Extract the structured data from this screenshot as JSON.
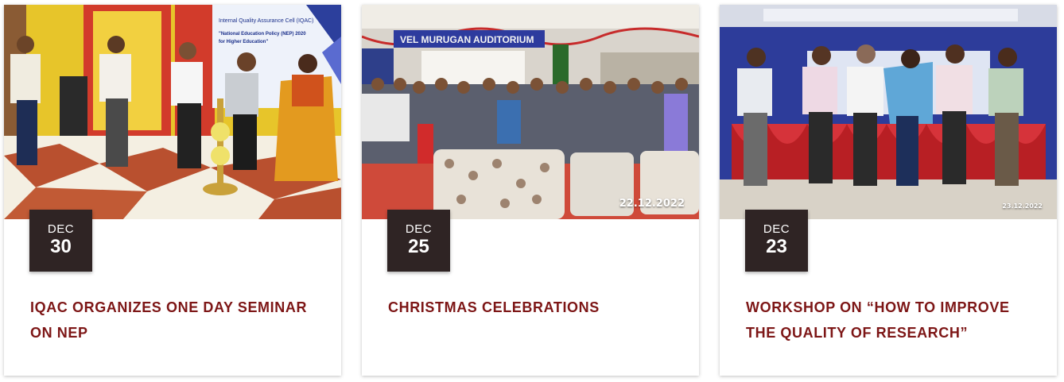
{
  "events": [
    {
      "month": "DEC",
      "day": "30",
      "title": "IQAC ORGANIZES ONE DAY SEMINAR ON NEP",
      "photo_text": [
        "Internal Quality Assurance Cell (IQAC)",
        "\"National Education Policy (NEP) 2020",
        "for Higher Education\""
      ]
    },
    {
      "month": "DEC",
      "day": "25",
      "title": "CHRISTMAS CELEBRATIONS",
      "photo_text": [
        "VEL MURUGAN AUDITORIUM"
      ],
      "photo_stamp": "22.12.2022"
    },
    {
      "month": "DEC",
      "day": "23",
      "title": "WORKSHOP ON “HOW TO IMPROVE THE QUALITY OF RESEARCH”",
      "photo_stamp": "23.12.2022"
    }
  ],
  "colors": {
    "title": "#7d1616",
    "badge_bg": "#2f2424",
    "badge_text": "#ffffff"
  }
}
